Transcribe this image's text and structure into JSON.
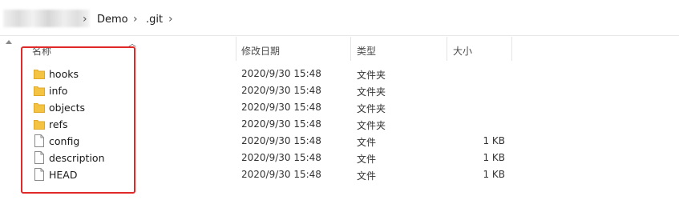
{
  "breadcrumb": {
    "items": [
      "Demo",
      ".git"
    ]
  },
  "columns": {
    "name": "名称",
    "date": "修改日期",
    "type": "类型",
    "size": "大小"
  },
  "files": [
    {
      "name": "hooks",
      "icon": "folder-icon",
      "date": "2020/9/30 15:48",
      "type": "文件夹",
      "size": ""
    },
    {
      "name": "info",
      "icon": "folder-icon",
      "date": "2020/9/30 15:48",
      "type": "文件夹",
      "size": ""
    },
    {
      "name": "objects",
      "icon": "folder-icon",
      "date": "2020/9/30 15:48",
      "type": "文件夹",
      "size": ""
    },
    {
      "name": "refs",
      "icon": "folder-icon",
      "date": "2020/9/30 15:48",
      "type": "文件夹",
      "size": ""
    },
    {
      "name": "config",
      "icon": "file-icon",
      "date": "2020/9/30 15:48",
      "type": "文件",
      "size": "1 KB"
    },
    {
      "name": "description",
      "icon": "file-icon",
      "date": "2020/9/30 15:48",
      "type": "文件",
      "size": "1 KB"
    },
    {
      "name": "HEAD",
      "icon": "file-icon",
      "date": "2020/9/30 15:48",
      "type": "文件",
      "size": "1 KB"
    }
  ],
  "colors": {
    "highlight": "#e02a2a",
    "folder": "#f5c342",
    "folder_dark": "#e0a82a"
  }
}
